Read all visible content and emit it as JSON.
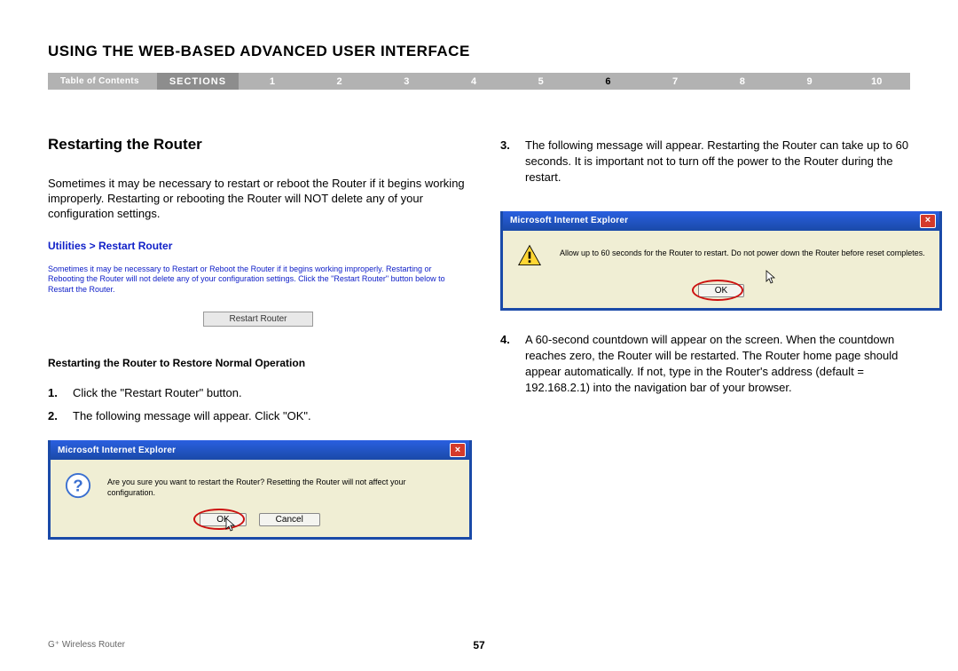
{
  "chapter_title": "USING THE WEB-BASED ADVANCED USER INTERFACE",
  "nav": {
    "toc_label": "Table of Contents",
    "sections_label": "SECTIONS",
    "numbers": [
      "1",
      "2",
      "3",
      "4",
      "5",
      "6",
      "7",
      "8",
      "9",
      "10"
    ],
    "active_index": 5
  },
  "heading": "Restarting the Router",
  "intro_para": "Sometimes it may be necessary to restart or reboot the Router if it begins working improperly. Restarting or rebooting the Router will NOT delete any of your configuration settings.",
  "util_panel": {
    "breadcrumb": "Utilities > Restart Router",
    "help_text": "Sometimes it may be necessary to Restart or Reboot the Router if it begins working improperly. Restarting or Rebooting the Router will not delete any of your configuration settings. Click the \"Restart Router\" button below to Restart the Router.",
    "button_label": "Restart Router"
  },
  "sub_heading": "Restarting the Router to Restore Normal Operation",
  "steps_left": [
    {
      "num": "1.",
      "text": "Click the \"Restart Router\" button."
    },
    {
      "num": "2.",
      "text": "The following message will appear. Click \"OK\"."
    }
  ],
  "dialog_confirm": {
    "title": "Microsoft Internet Explorer",
    "message": "Are you sure you want to restart the Router? Resetting the Router will not affect your configuration.",
    "ok_label": "OK",
    "cancel_label": "Cancel"
  },
  "steps_right": [
    {
      "num": "3.",
      "text": "The following message will appear. Restarting the Router can take up to 60 seconds. It is important not to turn off the power to the Router during the restart."
    }
  ],
  "dialog_wait": {
    "title": "Microsoft Internet Explorer",
    "message": "Allow up to 60 seconds for the Router to restart. Do not power down the Router before reset completes.",
    "ok_label": "OK"
  },
  "steps_right_after": [
    {
      "num": "4.",
      "text": "A 60-second countdown will appear on the screen. When the countdown reaches zero, the Router will be restarted. The Router home page should appear automatically. If not, type in the Router's address (default = 192.168.2.1) into the navigation bar of your browser."
    }
  ],
  "footer": {
    "product": "G⁺ Wireless Router",
    "page_number": "57"
  }
}
